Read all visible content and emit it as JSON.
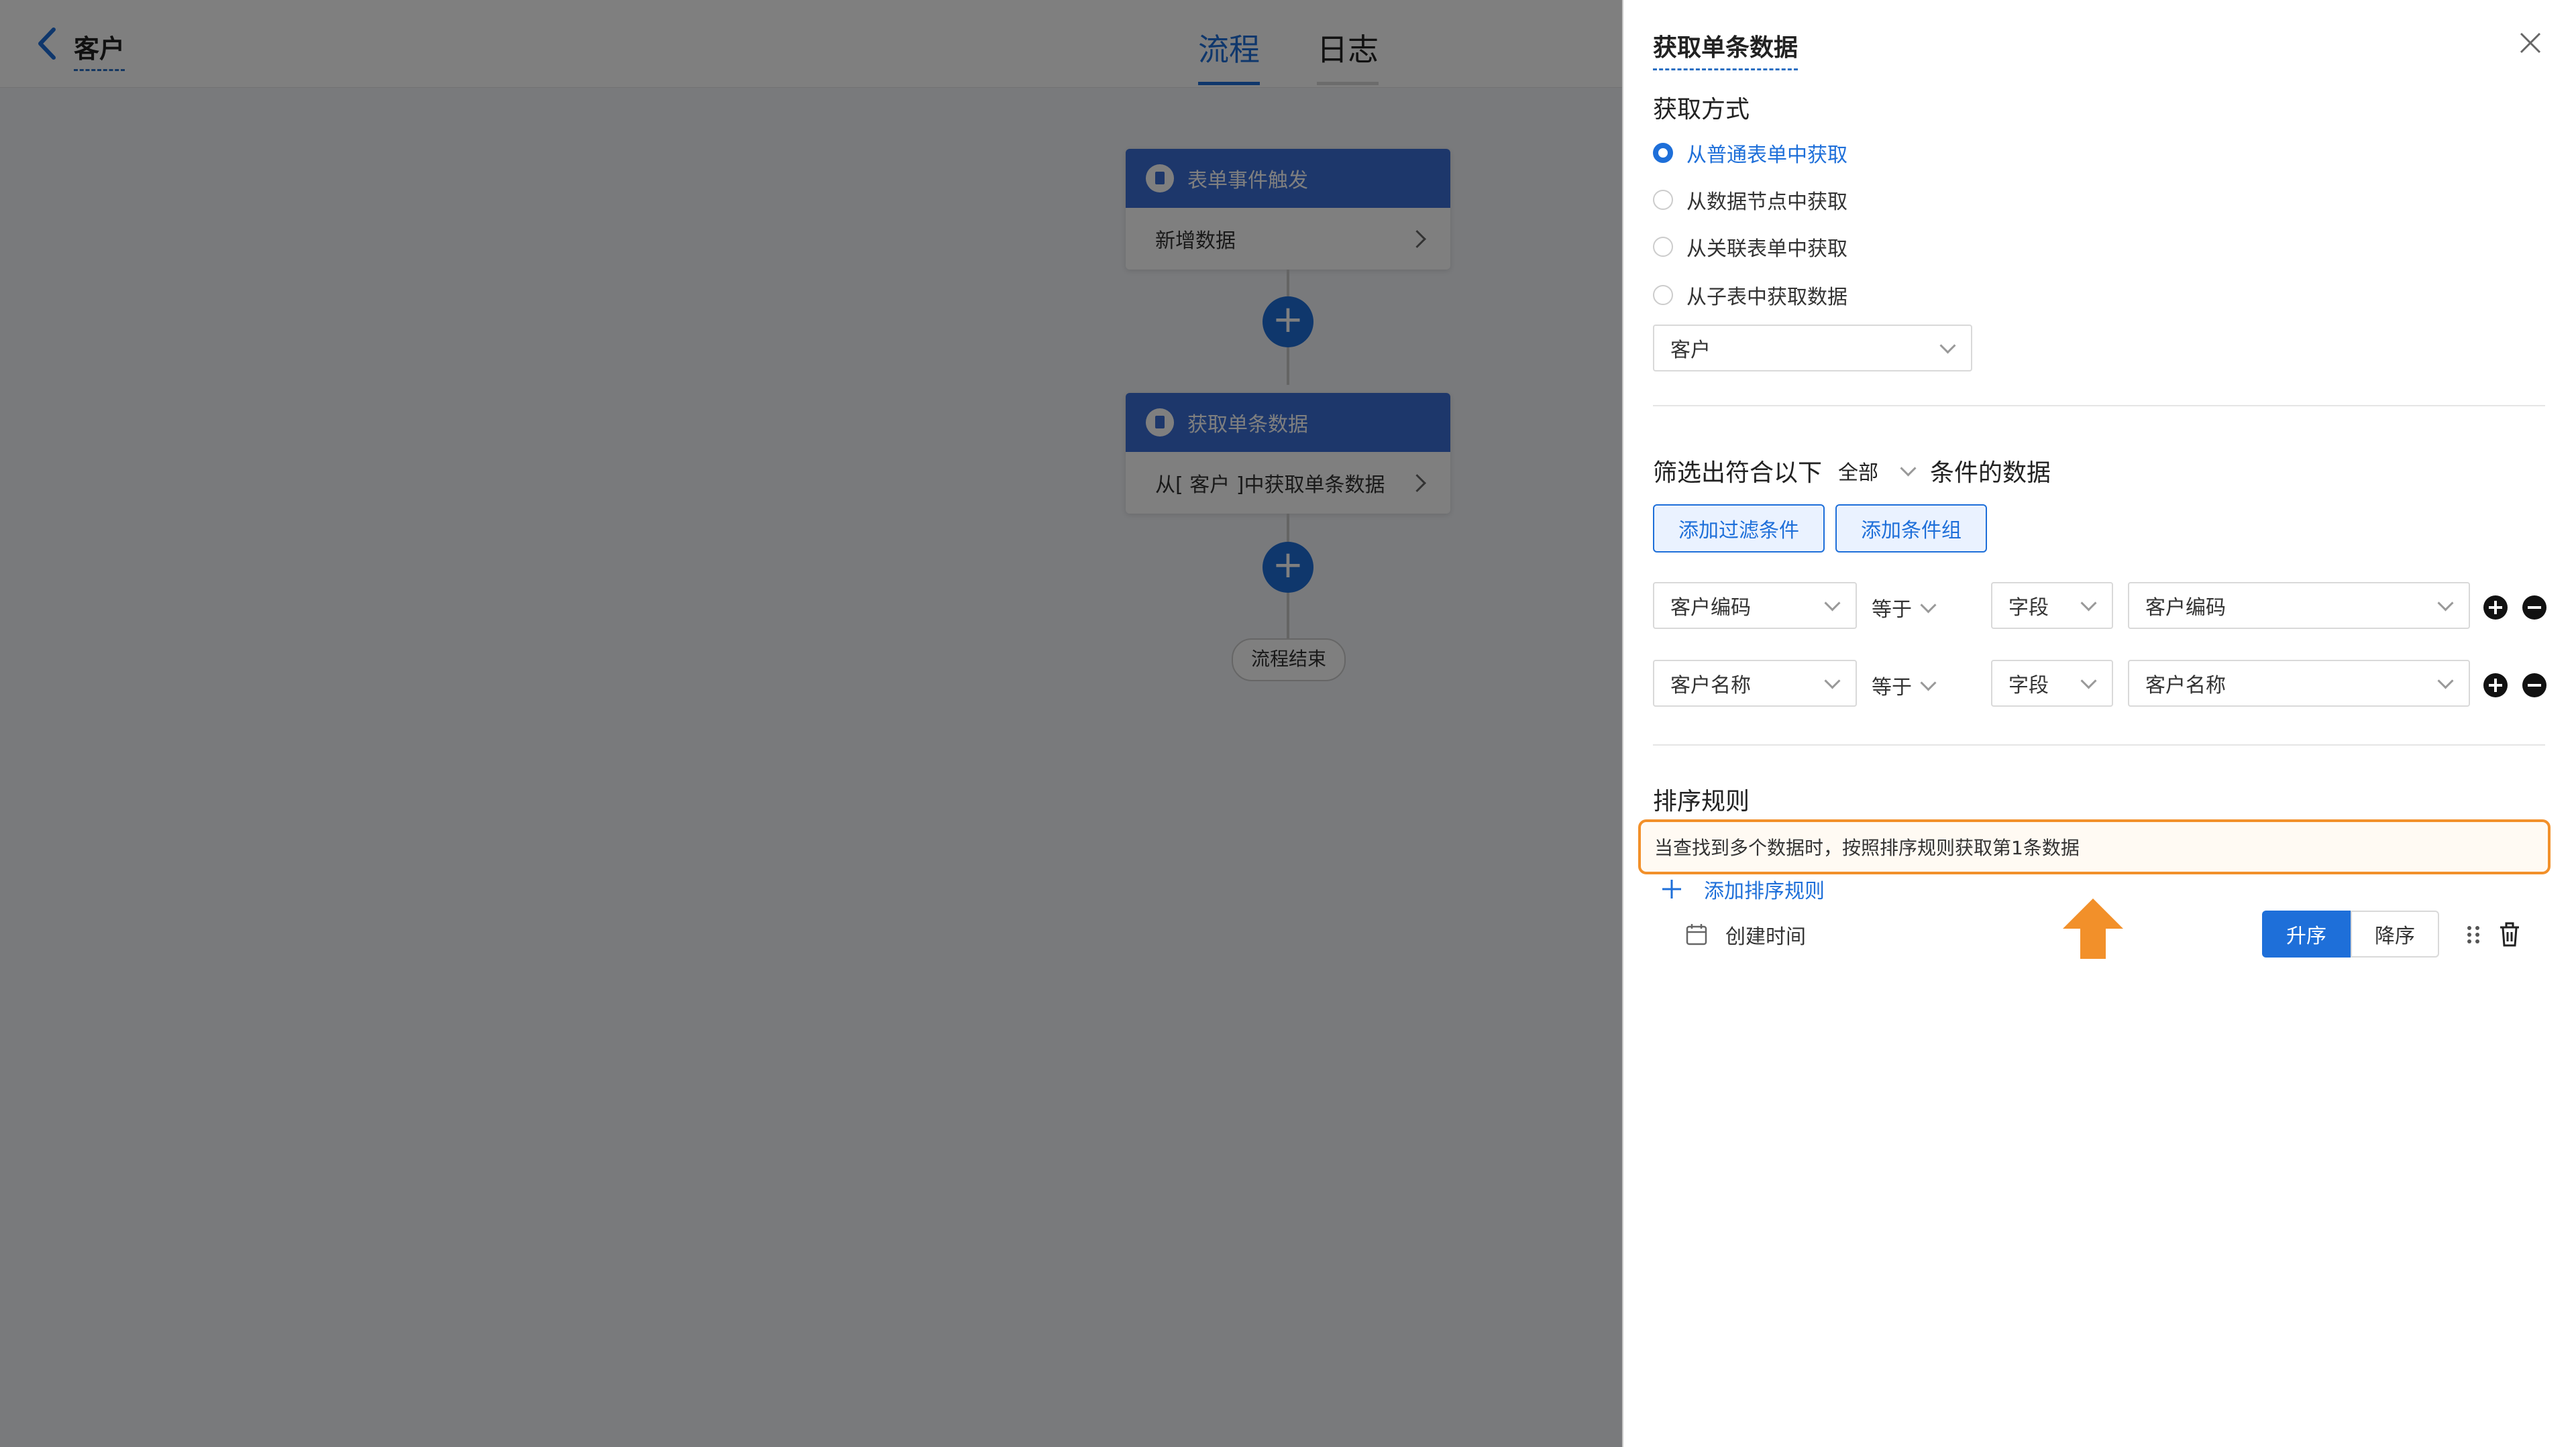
{
  "app": {
    "title": "客户",
    "tabs": [
      "流程",
      "日志"
    ],
    "active_tab": "流程"
  },
  "flow": {
    "nodes": [
      {
        "header": "表单事件触发",
        "body": "新增数据"
      },
      {
        "header": "获取单条数据",
        "body": "从[ 客户 ]中获取单条数据"
      }
    ],
    "end_label": "流程结束"
  },
  "panel": {
    "title": "获取单条数据",
    "get_method_label": "获取方式",
    "methods": [
      "从普通表单中获取",
      "从数据节点中获取",
      "从关联表单中获取",
      "从子表中获取数据"
    ],
    "selected_method_index": 0,
    "form_select": "客户",
    "filter_prefix": "筛选出符合以下",
    "filter_scope": "全部",
    "filter_suffix": "条件的数据",
    "add_filter_button": "添加过滤条件",
    "add_group_button": "添加条件组",
    "conditions": [
      {
        "field": "客户编码",
        "operator": "等于",
        "value_type": "字段",
        "value": "客户编码"
      },
      {
        "field": "客户名称",
        "operator": "等于",
        "value_type": "字段",
        "value": "客户名称"
      }
    ],
    "sort_label": "排序规则",
    "sort_hint": "当查找到多个数据时，按照排序规则获取第1条数据",
    "add_sort_label": "添加排序规则",
    "sort_field": "创建时间",
    "asc_label": "升序",
    "desc_label": "降序"
  },
  "colors": {
    "accent": "#1e6fd9",
    "highlight": "#f2902a"
  },
  "icons": [
    "back-icon",
    "close-icon",
    "plus-icon",
    "calendar-icon",
    "drag-handle-icon",
    "trash-icon",
    "arrow-up-icon"
  ]
}
